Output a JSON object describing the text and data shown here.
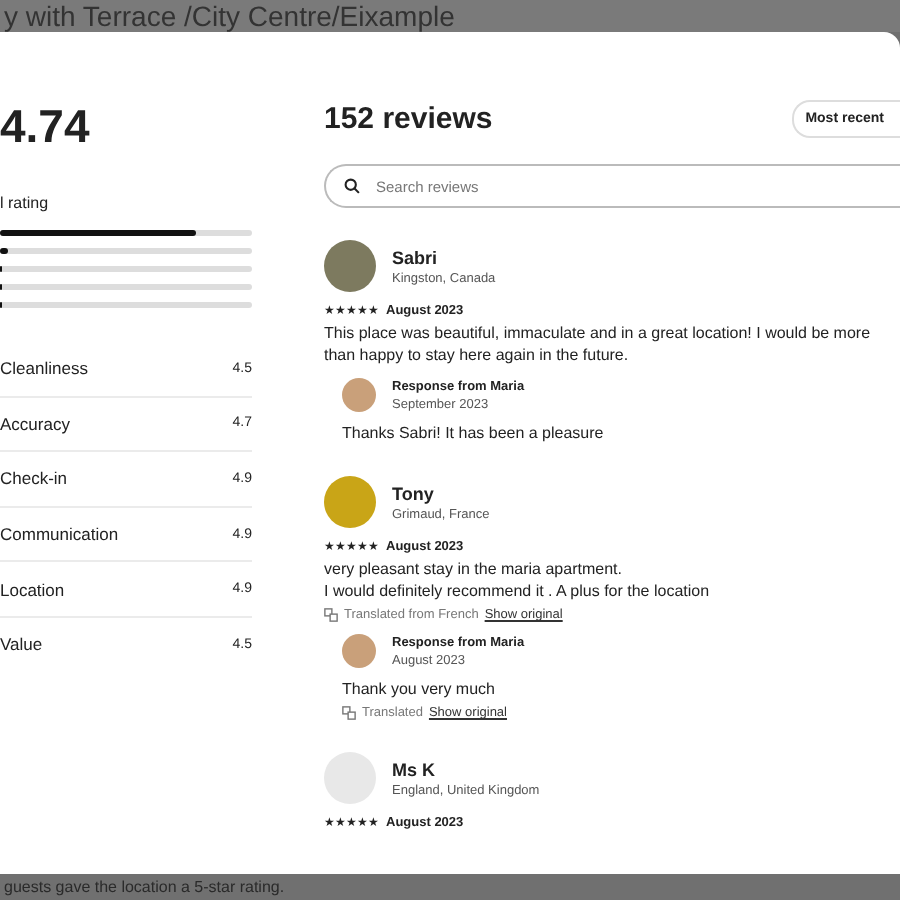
{
  "backdrop": {
    "title": "y with Terrace /City Centre/Eixample",
    "footer": "guests gave the location a 5-star rating."
  },
  "summary": {
    "score": "4.74",
    "label": "l rating",
    "bars": [
      {
        "level": 0.78
      },
      {
        "level": 0.03
      },
      {
        "level": 0
      },
      {
        "level": 0
      },
      {
        "level": 0
      }
    ],
    "categories": [
      {
        "name": "Cleanliness",
        "value": "4.5"
      },
      {
        "name": "Accuracy",
        "value": "4.7"
      },
      {
        "name": "Check-in",
        "value": "4.9"
      },
      {
        "name": "Communication",
        "value": "4.9"
      },
      {
        "name": "Location",
        "value": "4.9"
      },
      {
        "name": "Value",
        "value": "4.5"
      }
    ]
  },
  "reviews_header": {
    "title": "152 reviews",
    "sort": "Most recent",
    "search_placeholder": "Search reviews"
  },
  "reviews": [
    {
      "name": "Sabri",
      "location": "Kingston, Canada",
      "stars": 5,
      "date": "August 2023",
      "text": [
        "This place was beautiful, immaculate and in a great location! I would be more than happy to stay here again in the future."
      ],
      "response": {
        "title": "Response from Maria",
        "date": "September 2023",
        "text": "Thanks Sabri! It has been a pleasure"
      }
    },
    {
      "name": "Tony",
      "location": "Grimaud, France",
      "stars": 5,
      "date": "August 2023",
      "text": [
        "very pleasant stay in the maria apartment.",
        "I would definitely recommend it . A plus for the location"
      ],
      "translation": {
        "note": "Translated from French",
        "link": "Show original"
      },
      "response": {
        "title": "Response from Maria",
        "date": "August 2023",
        "text": "Thank you very much",
        "translation": {
          "note": "Translated",
          "link": "Show original"
        }
      }
    },
    {
      "name": "Ms K",
      "location": "England, United Kingdom",
      "stars": 5,
      "date": "August 2023"
    }
  ]
}
